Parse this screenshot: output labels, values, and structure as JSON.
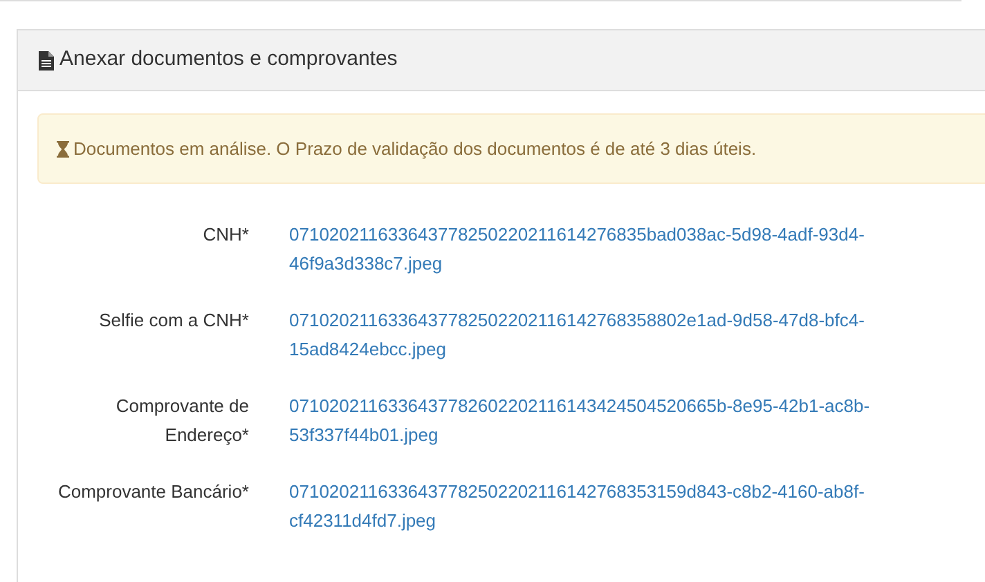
{
  "panel": {
    "title": "Anexar documentos e comprovantes"
  },
  "alert": {
    "text": "Documentos em análise. O Prazo de validação dos documentos é de até 3 dias úteis."
  },
  "documents": [
    {
      "label": "CNH*",
      "file": "071020211633643778250220211614276835bad038ac-5d98-4adf-93d4-46f9a3d338c7.jpeg"
    },
    {
      "label": "Selfie com a CNH*",
      "file": "0710202116336437782502202116142768358802e1ad-9d58-47d8-bfc4-15ad8424ebcc.jpeg"
    },
    {
      "label": "Comprovante de Endereço*",
      "file": "0710202116336437782602202116143424504520665b-8e95-42b1-ac8b-53f337f44b01.jpeg"
    },
    {
      "label": "Comprovante Bancário*",
      "file": "0710202116336437782502202116142768353159d843-c8b2-4160-ab8f-cf42311d4fd7.jpeg"
    }
  ]
}
